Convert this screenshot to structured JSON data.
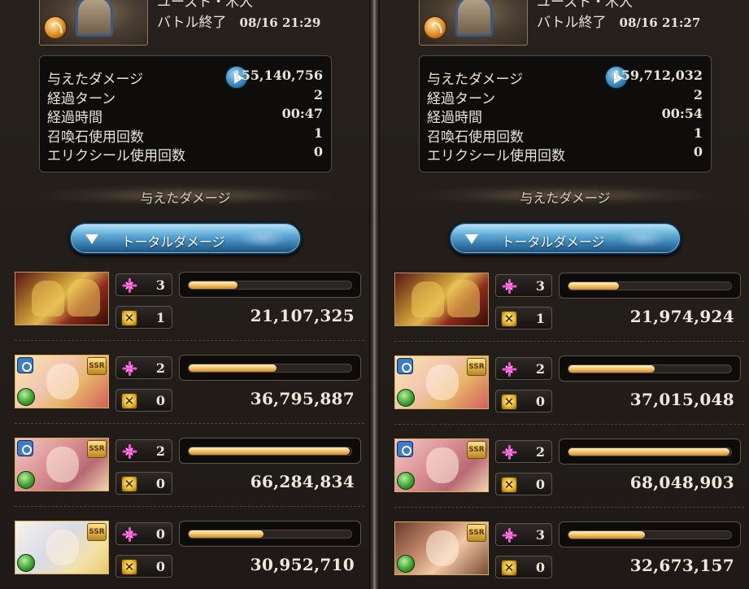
{
  "panels": [
    {
      "boss_name": "ユースト・木人",
      "battle_end_label": "バトル終了",
      "timestamp": "08/16 21:29",
      "stats": [
        {
          "label": "与えたダメージ",
          "value": "155,140,756"
        },
        {
          "label": "経過ターン",
          "value": "2"
        },
        {
          "label": "経過時間",
          "value": "00:47"
        },
        {
          "label": "召喚石使用回数",
          "value": "1"
        },
        {
          "label": "エリクシール使用回数",
          "value": "0"
        }
      ],
      "section_title": "与えたダメージ",
      "total_button_label": "トータルダメージ",
      "characters": [
        {
          "ca_count": "3",
          "seal_count": "1",
          "damage": "21,107,325",
          "bar_percent": 30
        },
        {
          "ca_count": "2",
          "seal_count": "0",
          "damage": "36,795,887",
          "bar_percent": 54
        },
        {
          "ca_count": "2",
          "seal_count": "0",
          "damage": "66,284,834",
          "bar_percent": 99
        },
        {
          "ca_count": "0",
          "seal_count": "0",
          "damage": "30,952,710",
          "bar_percent": 46
        }
      ]
    },
    {
      "boss_name": "ユースト・木人",
      "battle_end_label": "バトル終了",
      "timestamp": "08/16 21:27",
      "stats": [
        {
          "label": "与えたダメージ",
          "value": "159,712,032"
        },
        {
          "label": "経過ターン",
          "value": "2"
        },
        {
          "label": "経過時間",
          "value": "00:54"
        },
        {
          "label": "召喚石使用回数",
          "value": "1"
        },
        {
          "label": "エリクシール使用回数",
          "value": "0"
        }
      ],
      "section_title": "与えたダメージ",
      "total_button_label": "トータルダメージ",
      "characters": [
        {
          "ca_count": "3",
          "seal_count": "1",
          "damage": "21,974,924",
          "bar_percent": 31
        },
        {
          "ca_count": "2",
          "seal_count": "0",
          "damage": "37,015,048",
          "bar_percent": 53
        },
        {
          "ca_count": "2",
          "seal_count": "0",
          "damage": "68,048,903",
          "bar_percent": 99
        },
        {
          "ca_count": "3",
          "seal_count": "0",
          "damage": "32,673,157",
          "bar_percent": 47
        }
      ]
    }
  ],
  "icons": {
    "charge_attack": "pink-sparkle-icon",
    "seal": "gold-seal-icon",
    "play": "blue-play-icon",
    "dropdown": "down-triangle-icon"
  },
  "colors": {
    "bar_fill": "#f3c46a",
    "button_blue": "#5fa9d5",
    "charge_pink": "#ff4fd8"
  }
}
